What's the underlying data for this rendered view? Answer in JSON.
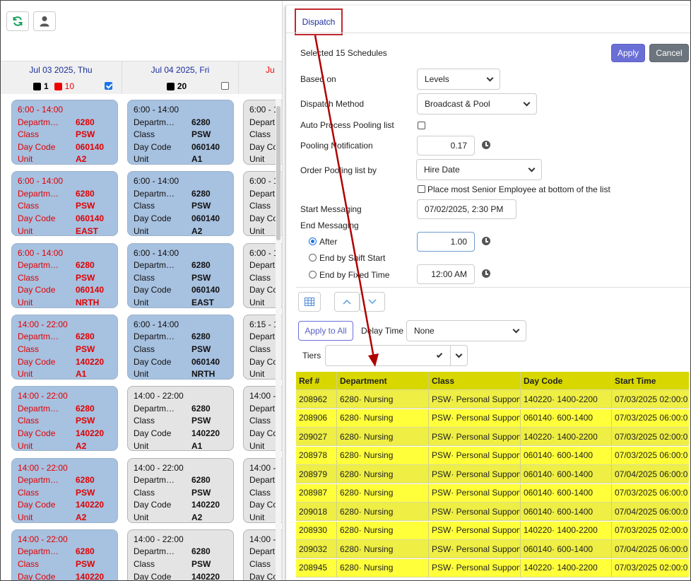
{
  "toolbar": {
    "refresh_icon": "refresh-icon",
    "user_icon": "user-icon"
  },
  "days": [
    {
      "title": "Jul 03 2025, Thu",
      "black_count": "1",
      "red_count": "10",
      "checked": true
    },
    {
      "title": "Jul 04 2025, Fri",
      "black_count": "20",
      "checked": false
    },
    {
      "title": "Ju"
    }
  ],
  "cards": {
    "labels": {
      "dept": "Departm…",
      "class": "Class",
      "daycode": "Day Code",
      "unit": "Unit",
      "dept_short": "Depart",
      "daycode_short": "Day Co"
    },
    "col1": [
      {
        "time": "6:00 - 14:00",
        "dept": "6280",
        "class": "PSW",
        "daycode": "060140",
        "unit": "A2"
      },
      {
        "time": "6:00 - 14:00",
        "dept": "6280",
        "class": "PSW",
        "daycode": "060140",
        "unit": "EAST"
      },
      {
        "time": "6:00 - 14:00",
        "dept": "6280",
        "class": "PSW",
        "daycode": "060140",
        "unit": "NRTH"
      },
      {
        "time": "14:00 - 22:00",
        "dept": "6280",
        "class": "PSW",
        "daycode": "140220",
        "unit": "A1"
      },
      {
        "time": "14:00 - 22:00",
        "dept": "6280",
        "class": "PSW",
        "daycode": "140220",
        "unit": "A2"
      },
      {
        "time": "14:00 - 22:00",
        "dept": "6280",
        "class": "PSW",
        "daycode": "140220",
        "unit": "A2"
      },
      {
        "time": "14:00 - 22:00",
        "dept": "6280",
        "class": "PSW",
        "daycode": "140220",
        "unit": ""
      }
    ],
    "col2": [
      {
        "time": "6:00 - 14:00",
        "dept": "6280",
        "class": "PSW",
        "daycode": "060140",
        "unit": "A1"
      },
      {
        "time": "6:00 - 14:00",
        "dept": "6280",
        "class": "PSW",
        "daycode": "060140",
        "unit": "A2"
      },
      {
        "time": "6:00 - 14:00",
        "dept": "6280",
        "class": "PSW",
        "daycode": "060140",
        "unit": "EAST"
      },
      {
        "time": "6:00 - 14:00",
        "dept": "6280",
        "class": "PSW",
        "daycode": "060140",
        "unit": "NRTH"
      },
      {
        "time": "14:00 - 22:00",
        "dept": "6280",
        "class": "PSW",
        "daycode": "140220",
        "unit": "A1"
      },
      {
        "time": "14:00 - 22:00",
        "dept": "6280",
        "class": "PSW",
        "daycode": "140220",
        "unit": "A2"
      },
      {
        "time": "14:00 - 22:00",
        "dept": "6280",
        "class": "PSW",
        "daycode": "140220",
        "unit": ""
      }
    ],
    "col3": [
      {
        "time": "6:00 - 1"
      },
      {
        "time": "6:00 - 1"
      },
      {
        "time": "6:00 - 1"
      },
      {
        "time": "6:15 - 1"
      },
      {
        "time": "14:00 -"
      },
      {
        "time": "14:00 -"
      },
      {
        "time": "14:00 -"
      }
    ]
  },
  "dispatch": {
    "tab": "Dispatch",
    "selected": "Selected 15 Schedules",
    "apply": "Apply",
    "cancel": "Cancel",
    "based_on_label": "Based on",
    "based_on_value": "Levels",
    "method_label": "Dispatch Method",
    "method_value": "Broadcast & Pool",
    "auto_process_label": "Auto Process Pooling list",
    "pooling_label": "Pooling Notification",
    "pooling_value": "0.17",
    "order_label": "Order Pooling list by",
    "order_value": "Hire Date",
    "senior_label": "Place most Senior Employee at bottom of the list",
    "start_label": "Start Messaging",
    "start_value": "07/02/2025, 2:30 PM",
    "end_label": "End Messaging",
    "after_label": "After",
    "after_value": "1.00",
    "end_shift_label": "End by Shift Start",
    "end_fixed_label": "End by Fixed Time",
    "fixed_value": "12:00 AM",
    "apply_all": "Apply to All",
    "delay_label": "Delay Time",
    "delay_value": "None",
    "tiers_label": "Tiers"
  },
  "grid": {
    "headers": [
      "Ref #",
      "Department",
      "Class",
      "Day Code",
      "Start Time"
    ],
    "rows": [
      [
        "208962",
        "6280· Nursing",
        "PSW· Personal Support",
        "140220· 1400-2200",
        "07/03/2025 02:00:0"
      ],
      [
        "208906",
        "6280· Nursing",
        "PSW· Personal Support",
        "060140· 600-1400",
        "07/03/2025 06:00:0"
      ],
      [
        "209027",
        "6280· Nursing",
        "PSW· Personal Support",
        "140220· 1400-2200",
        "07/03/2025 02:00:0"
      ],
      [
        "208978",
        "6280· Nursing",
        "PSW· Personal Support",
        "060140· 600-1400",
        "07/03/2025 06:00:0"
      ],
      [
        "208979",
        "6280· Nursing",
        "PSW· Personal Support",
        "060140· 600-1400",
        "07/04/2025 06:00:0"
      ],
      [
        "208987",
        "6280· Nursing",
        "PSW· Personal Support",
        "060140· 600-1400",
        "07/03/2025 06:00:0"
      ],
      [
        "209018",
        "6280· Nursing",
        "PSW· Personal Support",
        "060140· 600-1400",
        "07/04/2025 06:00:0"
      ],
      [
        "208930",
        "6280· Nursing",
        "PSW· Personal Support",
        "140220· 1400-2200",
        "07/03/2025 02:00:0"
      ],
      [
        "209032",
        "6280· Nursing",
        "PSW· Personal Support",
        "060140· 600-1400",
        "07/04/2025 06:00:0"
      ],
      [
        "208945",
        "6280· Nursing",
        "PSW· Personal Support",
        "140220· 1400-2200",
        "07/03/2025 02:00:0"
      ]
    ]
  },
  "colors": {
    "accent": "#6a6fd6",
    "highlight": "#ffff3a",
    "annotation": "#c0282d",
    "card_blue": "#a7c1e0",
    "alert_red": "#e00000"
  }
}
